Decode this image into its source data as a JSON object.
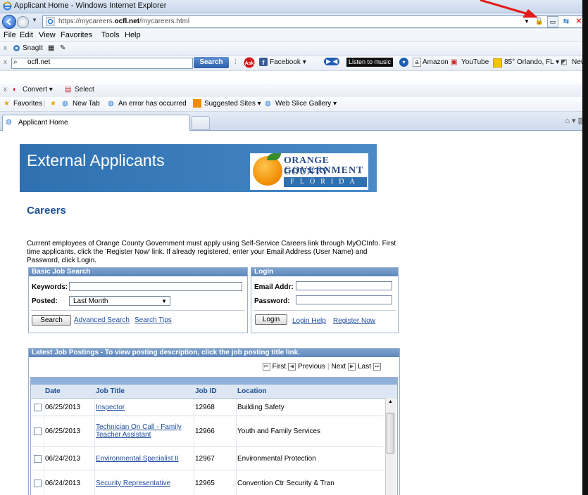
{
  "window": {
    "title": "Applicant Home - Windows Internet Explorer"
  },
  "address": {
    "url_prefix": "https://mycareers.",
    "url_bold": "ocfl.net",
    "url_suffix": "/mycareers.html"
  },
  "menu": {
    "file": "File",
    "edit": "Edit",
    "view": "View",
    "favorites": "Favorites",
    "tools": "Tools",
    "help": "Help"
  },
  "toolbar1": {
    "snagit": "SnagIt"
  },
  "toolbar2": {
    "search_value": "ocfl.net",
    "search_label": "Search",
    "facebook": "Facebook",
    "listen": "Listen to music",
    "amazon": "Amazon",
    "youtube": "YouTube",
    "weather": "85° Orlando, FL",
    "news": "New"
  },
  "toolbar3": {
    "convert": "Convert",
    "select": "Select"
  },
  "favbar": {
    "favorites": "Favorites",
    "new_tab": "New Tab",
    "error": "An error has occurred",
    "suggested": "Suggested Sites",
    "slice": "Web Slice Gallery"
  },
  "tab": {
    "label": "Applicant Home"
  },
  "page": {
    "banner_title": "External Applicants",
    "logo": {
      "line1": "ORANGE COUNTY",
      "line2": "GOVERNMENT",
      "line3": "FLORIDA"
    },
    "careers": "Careers",
    "intro": "Current employees of Orange County Government must apply using Self-Service Careers link through MyOCInfo. First time applicants, click the 'Register Now' link. If already registered, enter your Email Address (User Name) and Password, click Login.",
    "basic_search": {
      "header": "Basic Job Search",
      "keywords_label": "Keywords:",
      "posted_label": "Posted:",
      "posted_value": "Last Month",
      "search_button": "Search",
      "advanced": "Advanced Search",
      "tips": "Search Tips"
    },
    "login": {
      "header": "Login",
      "email_label": "Email Addr:",
      "password_label": "Password:",
      "login_button": "Login",
      "help": "Login Help",
      "register": "Register Now"
    },
    "postings": {
      "header": "Latest Job Postings - To view posting description, click the job posting title link.",
      "first": "First",
      "previous": "Previous",
      "next": "Next",
      "last": "Last",
      "columns": {
        "date": "Date",
        "title": "Job Title",
        "id": "Job ID",
        "location": "Location"
      },
      "rows": [
        {
          "date": "06/25/2013",
          "title": "Inspector",
          "id": "12968",
          "location": "Building Safety"
        },
        {
          "date": "06/25/2013",
          "title": "Technician On Call - Family Teacher Assistant",
          "id": "12966",
          "location": "Youth and Family Services"
        },
        {
          "date": "06/24/2013",
          "title": "Environmental Specialist II",
          "id": "12967",
          "location": "Environmental Protection"
        },
        {
          "date": "06/24/2013",
          "title": "Security Representative",
          "id": "12965",
          "location": "Convention Ctr Security & Tran"
        }
      ]
    }
  }
}
